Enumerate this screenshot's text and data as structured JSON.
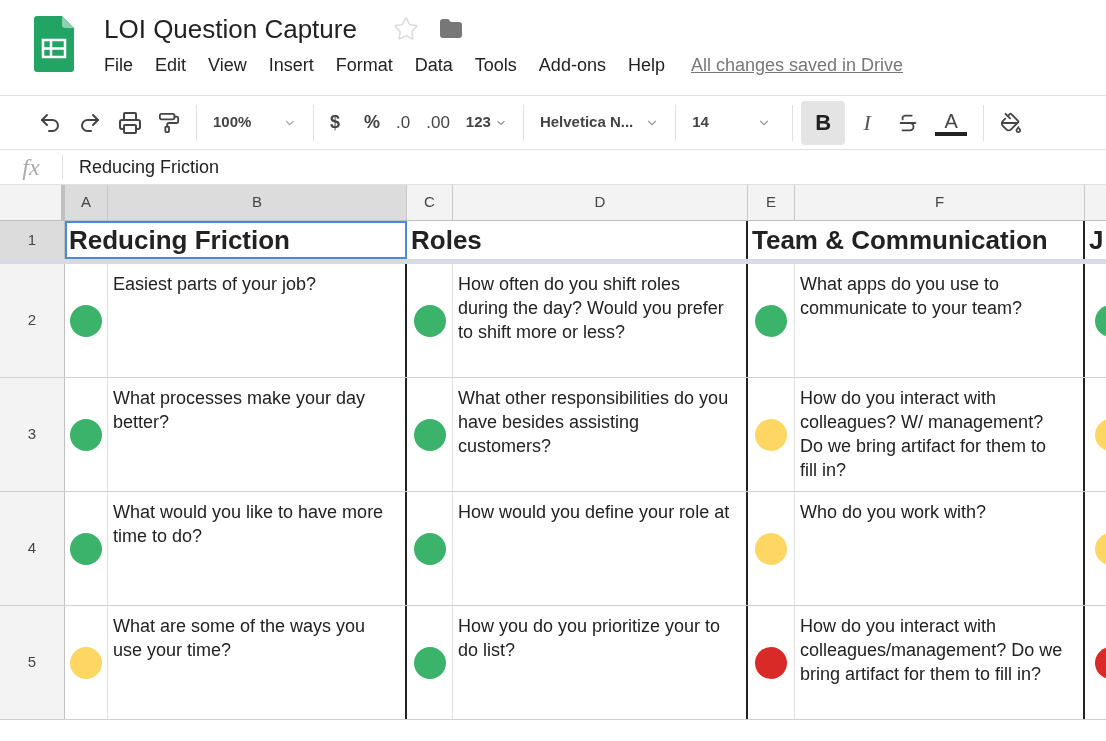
{
  "document": {
    "title": "LOI Question Capture",
    "save_status": "All changes saved in Drive"
  },
  "menu": [
    "File",
    "Edit",
    "View",
    "Insert",
    "Format",
    "Data",
    "Tools",
    "Add-ons",
    "Help"
  ],
  "toolbar": {
    "zoom": "100%",
    "currency": "$",
    "percent": "%",
    "decrease_decimals": ".0",
    "increase_decimals": ".00",
    "number_format": "123",
    "font": "Helvetica N...",
    "font_size": "14",
    "bold": {
      "label": "B",
      "on": true
    },
    "italic": {
      "label": "I",
      "on": false
    },
    "text_color": "A"
  },
  "formula_bar": {
    "label": "fx",
    "value": "Reducing Friction"
  },
  "column_headers": [
    "A",
    "B",
    "C",
    "D",
    "E",
    "F"
  ],
  "row_numbers": [
    "1",
    "2",
    "3",
    "4",
    "5"
  ],
  "sections": [
    {
      "title": "Reducing Friction",
      "selected": true,
      "questions": [
        {
          "color": "#3cb36a",
          "text": "Easiest parts of your job?"
        },
        {
          "color": "#3cb36a",
          "text": "What processes make your day better?"
        },
        {
          "color": "#3cb36a",
          "text": "What would you like to have more time to do?"
        },
        {
          "color": "#fdd663",
          "text": "What are some of the ways you use your time?"
        }
      ]
    },
    {
      "title": "Roles",
      "selected": false,
      "questions": [
        {
          "color": "#3cb36a",
          "text": "How often do you shift roles during the day? Would you prefer to shift more or less?"
        },
        {
          "color": "#3cb36a",
          "text": "What other responsibilities do you have besides assisting customers?"
        },
        {
          "color": "#3cb36a",
          "text": "How would you define your role at"
        },
        {
          "color": "#3cb36a",
          "text": "How you do you prioritize your to do list?"
        }
      ]
    },
    {
      "title": "Team & Communication",
      "selected": false,
      "questions": [
        {
          "color": "#3cb36a",
          "text": "What apps do you use to communicate to your team?"
        },
        {
          "color": "#fdd663",
          "text": "How do you interact with colleagues? W/ management? Do we bring artifact for them to fill in?"
        },
        {
          "color": "#fdd663",
          "text": "Who do you work with?"
        },
        {
          "color": "#d92a27",
          "text": "How do you interact with colleagues/management? Do we bring artifact for them to fill in?"
        }
      ]
    },
    {
      "title": "J",
      "selected": false,
      "questions": [
        {
          "color": "#3cb36a"
        },
        {
          "color": "#fdd663"
        },
        {
          "color": "#fdd663"
        },
        {
          "color": "#d92a27"
        }
      ]
    }
  ]
}
